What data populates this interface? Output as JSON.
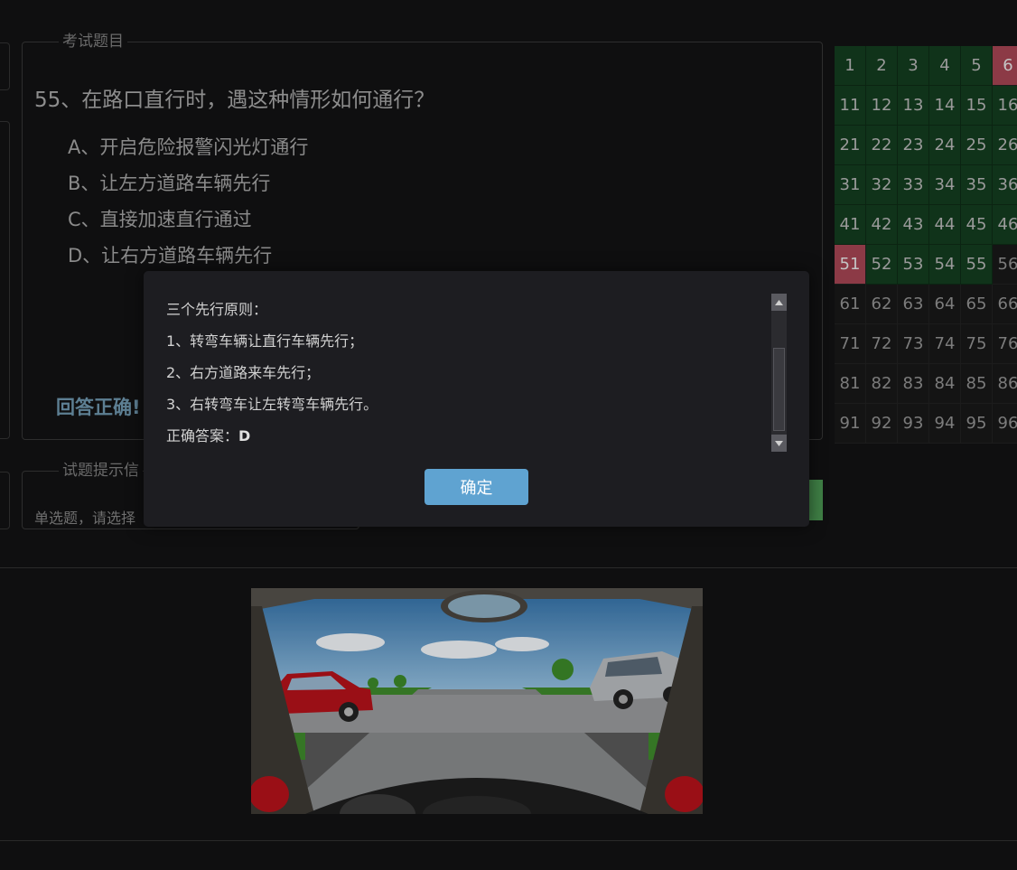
{
  "question": {
    "panel_title": "考试题目",
    "title": "55、在路口直行时，遇这种情形如何通行？",
    "options": [
      {
        "label": "A、开启危险报警闪光灯通行"
      },
      {
        "label": "B、让左方道路车辆先行"
      },
      {
        "label": "C、直接加速直行通过"
      },
      {
        "label": "D、让右方道路车辆先行"
      }
    ],
    "feedback": "回答正确!"
  },
  "hint": {
    "panel_title": "试题提示信",
    "text": "单选题，请选择"
  },
  "grid": {
    "cells": [
      {
        "n": "1",
        "s": "correct"
      },
      {
        "n": "2",
        "s": "correct"
      },
      {
        "n": "3",
        "s": "correct"
      },
      {
        "n": "4",
        "s": "correct"
      },
      {
        "n": "5",
        "s": "correct"
      },
      {
        "n": "6",
        "s": "wrong"
      },
      {
        "n": "11",
        "s": "correct"
      },
      {
        "n": "12",
        "s": "correct"
      },
      {
        "n": "13",
        "s": "correct"
      },
      {
        "n": "14",
        "s": "correct"
      },
      {
        "n": "15",
        "s": "correct"
      },
      {
        "n": "16",
        "s": "correct"
      },
      {
        "n": "21",
        "s": "correct"
      },
      {
        "n": "22",
        "s": "correct"
      },
      {
        "n": "23",
        "s": "correct"
      },
      {
        "n": "24",
        "s": "correct"
      },
      {
        "n": "25",
        "s": "correct"
      },
      {
        "n": "26",
        "s": "correct"
      },
      {
        "n": "31",
        "s": "correct"
      },
      {
        "n": "32",
        "s": "correct"
      },
      {
        "n": "33",
        "s": "correct"
      },
      {
        "n": "34",
        "s": "correct"
      },
      {
        "n": "35",
        "s": "correct"
      },
      {
        "n": "36",
        "s": "correct"
      },
      {
        "n": "41",
        "s": "correct"
      },
      {
        "n": "42",
        "s": "correct"
      },
      {
        "n": "43",
        "s": "correct"
      },
      {
        "n": "44",
        "s": "correct"
      },
      {
        "n": "45",
        "s": "correct"
      },
      {
        "n": "46",
        "s": "correct"
      },
      {
        "n": "51",
        "s": "wrong"
      },
      {
        "n": "52",
        "s": "correct"
      },
      {
        "n": "53",
        "s": "correct"
      },
      {
        "n": "54",
        "s": "correct"
      },
      {
        "n": "55",
        "s": "correct"
      },
      {
        "n": "56",
        "s": "none"
      },
      {
        "n": "61",
        "s": "none"
      },
      {
        "n": "62",
        "s": "none"
      },
      {
        "n": "63",
        "s": "none"
      },
      {
        "n": "64",
        "s": "none"
      },
      {
        "n": "65",
        "s": "none"
      },
      {
        "n": "66",
        "s": "none"
      },
      {
        "n": "71",
        "s": "none"
      },
      {
        "n": "72",
        "s": "none"
      },
      {
        "n": "73",
        "s": "none"
      },
      {
        "n": "74",
        "s": "none"
      },
      {
        "n": "75",
        "s": "none"
      },
      {
        "n": "76",
        "s": "none"
      },
      {
        "n": "81",
        "s": "none"
      },
      {
        "n": "82",
        "s": "none"
      },
      {
        "n": "83",
        "s": "none"
      },
      {
        "n": "84",
        "s": "none"
      },
      {
        "n": "85",
        "s": "none"
      },
      {
        "n": "86",
        "s": "none"
      },
      {
        "n": "91",
        "s": "none"
      },
      {
        "n": "92",
        "s": "none"
      },
      {
        "n": "93",
        "s": "none"
      },
      {
        "n": "94",
        "s": "none"
      },
      {
        "n": "95",
        "s": "none"
      },
      {
        "n": "96",
        "s": "none"
      }
    ]
  },
  "modal": {
    "lines": [
      "三个先行原则：",
      "1、转弯车辆让直行车辆先行；",
      "2、右方道路来车先行；",
      "3、右转弯车让左转弯车辆先行。"
    ],
    "answer_label": "正确答案：",
    "answer_value": "D",
    "confirm_label": "确定"
  },
  "colors": {
    "correct_cell": "#10331a",
    "wrong_cell": "#8c3a46",
    "confirm_button": "#5fa3d1",
    "feedback_text": "#5d7f93"
  },
  "icons": [
    "scroll-up-arrow-icon",
    "scroll-down-arrow-icon"
  ]
}
